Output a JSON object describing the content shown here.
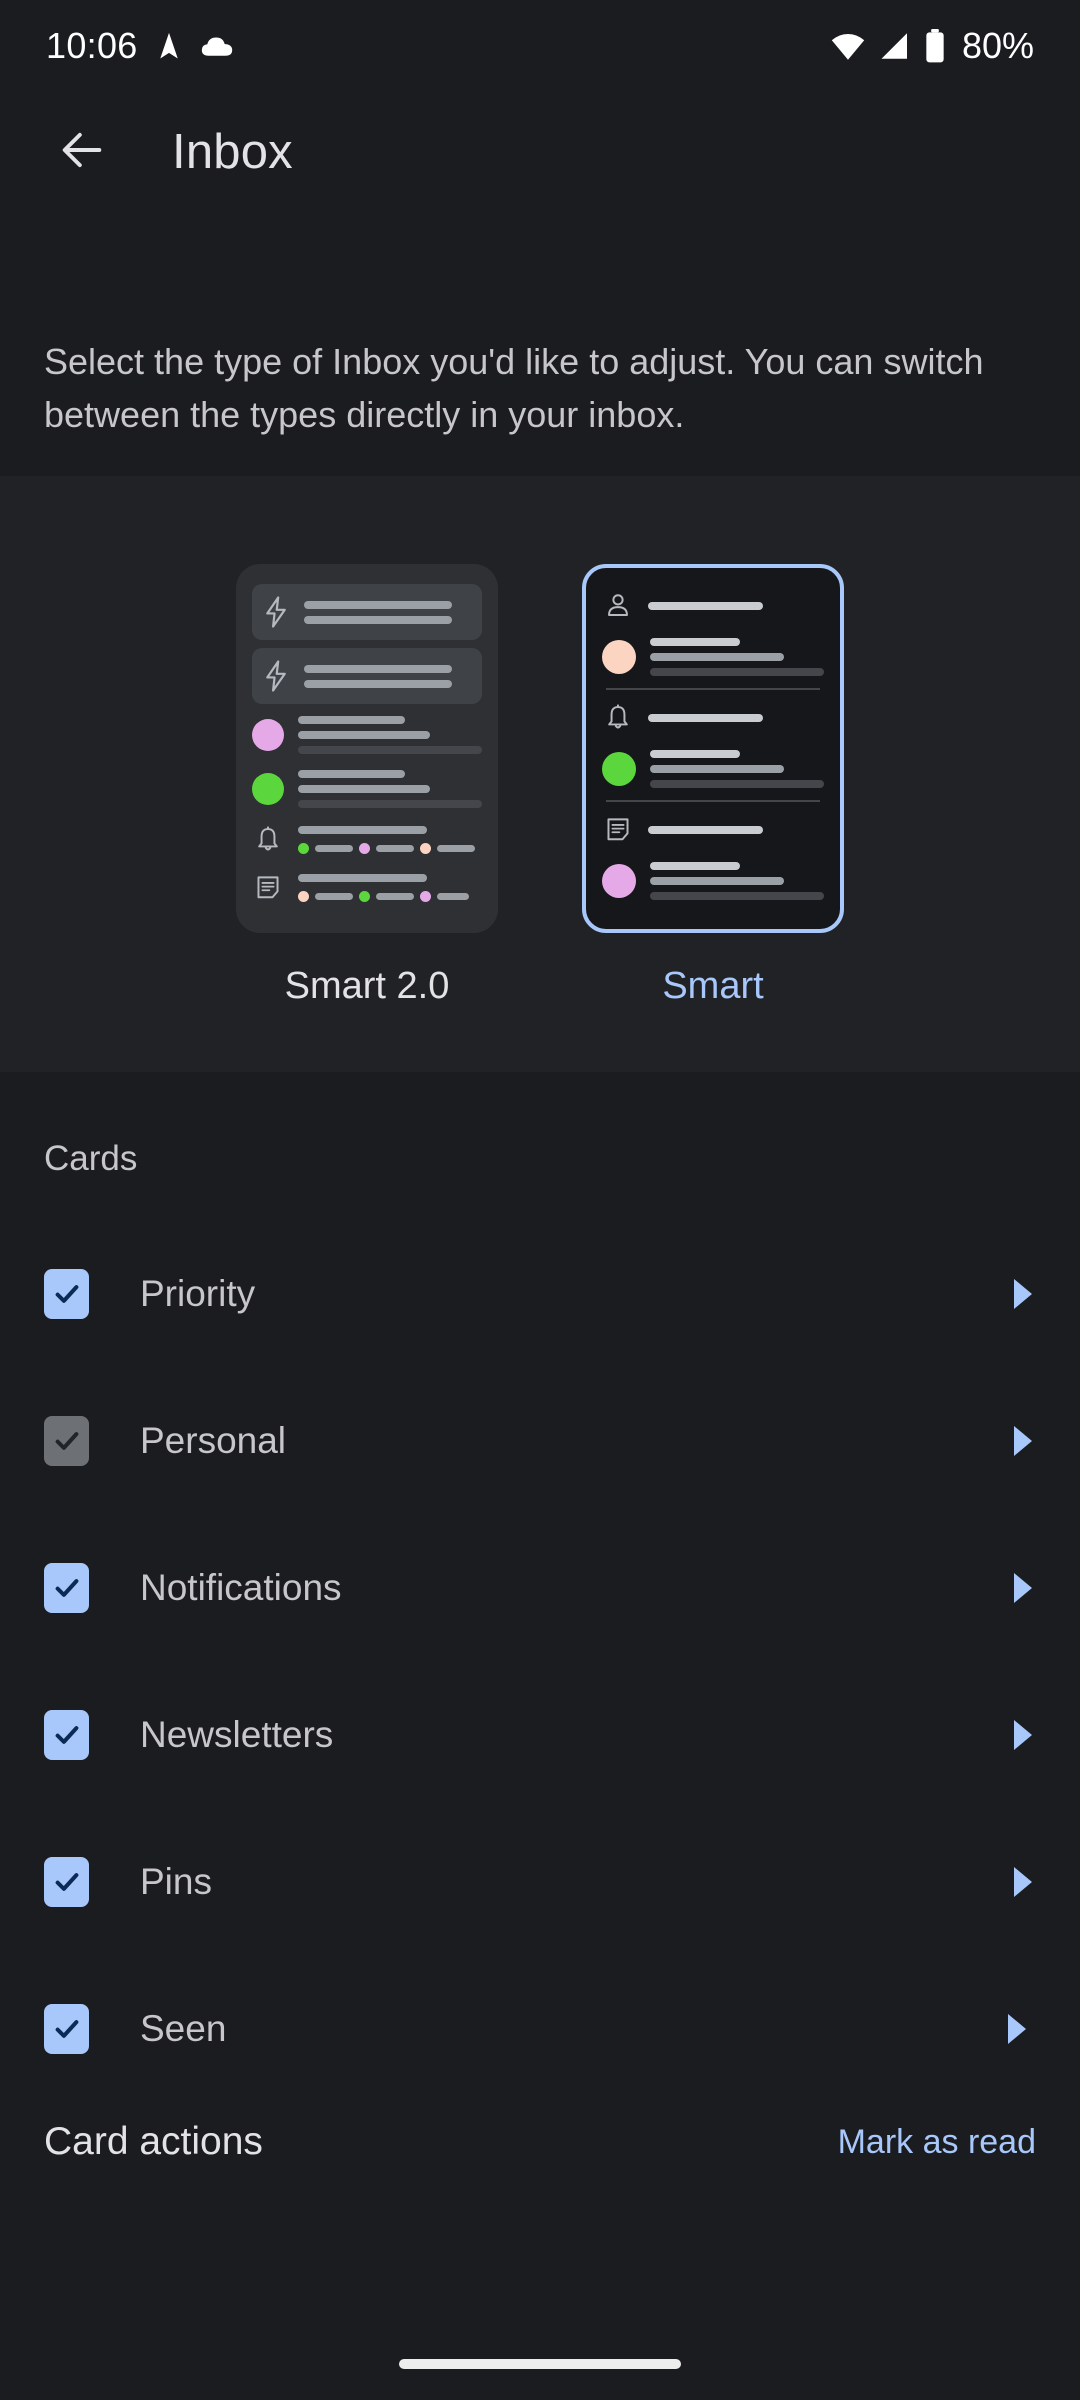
{
  "status_bar": {
    "time": "10:06",
    "battery_text": "80%",
    "icons": [
      "navigation-arrow-icon",
      "cloud-icon",
      "wifi-icon",
      "cell-signal-icon",
      "battery-icon"
    ]
  },
  "app_bar": {
    "back_icon": "arrow-left-icon",
    "title": "Inbox"
  },
  "description": "Select the type of Inbox you'd like to adjust. You can switch between the types directly in your inbox.",
  "type_picker": {
    "options": [
      {
        "label": "Smart 2.0",
        "selected": false
      },
      {
        "label": "Smart",
        "selected": true
      }
    ],
    "selected_color": "#A8C7FA",
    "unselected_color": "#E3E3E6"
  },
  "cards_section": {
    "heading": "Cards",
    "items": [
      {
        "label": "Priority",
        "checked": true,
        "disabled": false,
        "chevron": "chevron-right-icon"
      },
      {
        "label": "Personal",
        "checked": true,
        "disabled": true,
        "chevron": "chevron-right-icon"
      },
      {
        "label": "Notifications",
        "checked": true,
        "disabled": false,
        "chevron": "chevron-right-icon"
      },
      {
        "label": "Newsletters",
        "checked": true,
        "disabled": false,
        "chevron": "chevron-right-icon"
      },
      {
        "label": "Pins",
        "checked": true,
        "disabled": false,
        "chevron": "chevron-right-icon"
      },
      {
        "label": "Seen",
        "checked": true,
        "disabled": false,
        "chevron": "chevron-right-icon"
      }
    ]
  },
  "card_actions": {
    "label": "Card actions",
    "action_label": "Mark as read"
  },
  "colors": {
    "background": "#1B1C20",
    "picker_background": "#212226",
    "accent_blue": "#A8C7FA",
    "avatar_pink": "#E5A9E8",
    "avatar_green": "#5BD63D",
    "avatar_peach": "#FBD4C2",
    "text_primary": "#E3E3E6",
    "text_secondary": "#C7C6CA"
  }
}
